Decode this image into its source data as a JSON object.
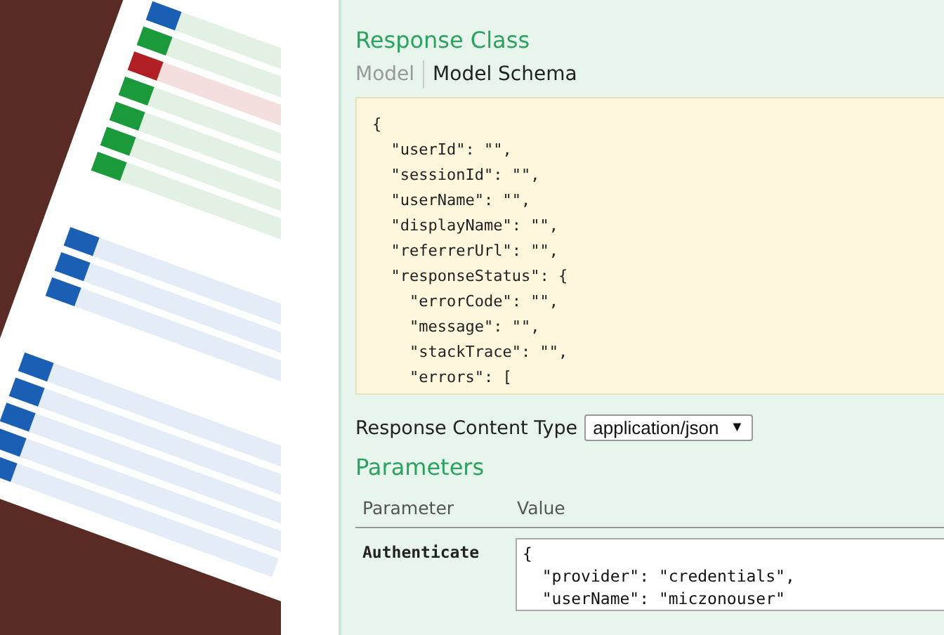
{
  "response_class": {
    "title": "Response Class",
    "tabs": [
      {
        "label": "Model",
        "selected": false
      },
      {
        "label": "Model Schema",
        "selected": true
      }
    ],
    "schema_lines": [
      "{",
      "  \"userId\": \"\",",
      "  \"sessionId\": \"\",",
      "  \"userName\": \"\",",
      "  \"displayName\": \"\",",
      "  \"referrerUrl\": \"\",",
      "  \"responseStatus\": {",
      "    \"errorCode\": \"\",",
      "    \"message\": \"\",",
      "    \"stackTrace\": \"\",",
      "    \"errors\": ["
    ]
  },
  "content_type": {
    "label": "Response Content Type",
    "value": "application/json",
    "arrow": "▼"
  },
  "parameters": {
    "title": "Parameters",
    "columns": [
      "Parameter",
      "Value"
    ],
    "rows": [
      {
        "name": "Authenticate",
        "value": "{\n  \"provider\": \"credentials\",\n  \"userName\": \"miczonouser\""
      }
    ]
  }
}
